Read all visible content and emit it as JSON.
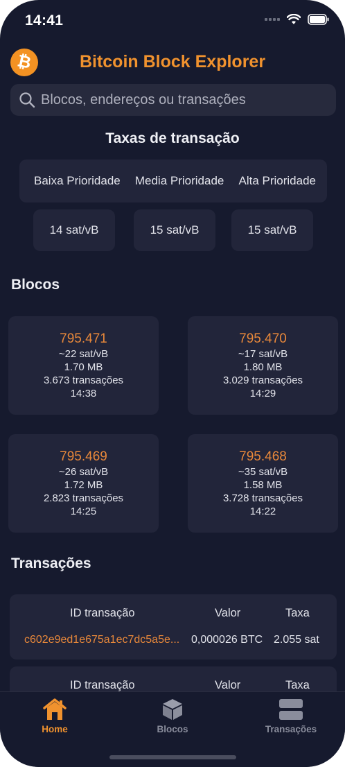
{
  "status_bar": {
    "time": "14:41"
  },
  "header": {
    "title": "Bitcoin Block Explorer",
    "logo_symbol": "₿"
  },
  "search": {
    "placeholder": "Blocos, endereços ou transações"
  },
  "fees": {
    "title": "Taxas de transação",
    "labels": [
      "Baixa Prioridade",
      "Media Prioridade",
      "Alta Prioridade"
    ],
    "values": [
      "14 sat/vB",
      "15 sat/vB",
      "15 sat/vB"
    ]
  },
  "blocks": {
    "title": "Blocos",
    "items": [
      {
        "height": "795.471",
        "fee": "~22 sat/vB",
        "size": "1.70 MB",
        "txs": "3.673 transações",
        "time": "14:38"
      },
      {
        "height": "795.470",
        "fee": "~17 sat/vB",
        "size": "1.80 MB",
        "txs": "3.029 transações",
        "time": "14:29"
      },
      {
        "height": "795.469",
        "fee": "~26 sat/vB",
        "size": "1.72 MB",
        "txs": "2.823 transações",
        "time": "14:25"
      },
      {
        "height": "795.468",
        "fee": "~35 sat/vB",
        "size": "1.58 MB",
        "txs": "3.728 transações",
        "time": "14:22"
      }
    ]
  },
  "transactions": {
    "title": "Transações",
    "headers": {
      "id": "ID transação",
      "value": "Valor",
      "fee": "Taxa"
    },
    "rows": [
      {
        "id": "c602e9ed1e675a1ec7dc5a5e...",
        "value": "0,000026 BTC",
        "fee": "2.055 sat"
      }
    ]
  },
  "tabbar": {
    "tabs": [
      {
        "label": "Home",
        "icon": "house-icon",
        "active": true
      },
      {
        "label": "Blocos",
        "icon": "cube-icon",
        "active": false
      },
      {
        "label": "Transações",
        "icon": "stack-icon",
        "active": false
      }
    ]
  },
  "colors": {
    "accent": "#f0922e",
    "background": "#161a2e",
    "card": "#22253a",
    "inactive": "#8a8d9c"
  }
}
